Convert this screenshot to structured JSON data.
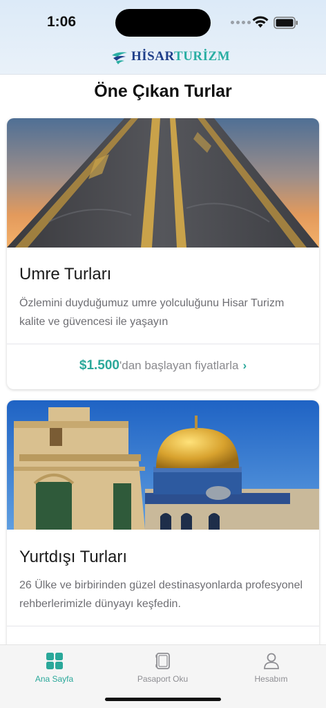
{
  "status_bar": {
    "time": "1:06"
  },
  "header": {
    "logo_part1": "HİSAR",
    "logo_part2": "TURİZM"
  },
  "page": {
    "title": "Öne Çıkan Turlar"
  },
  "cards": [
    {
      "title": "Umre Turları",
      "description": "Özlemini duyduğumuz umre yolculuğunu Hisar Turizm kalite ve güvencesi ile yaşayın",
      "price_amount": "$1.500",
      "price_suffix": "'dan başlayan fiyatlarla",
      "image": "kaaba-kiswah-photo"
    },
    {
      "title": "Yurtdışı Turları",
      "description": "26 Ülke ve birbirinden güzel destinasyonlarda profesyonel rehberlerimizle dünyayı keşfedin.",
      "image": "dome-of-the-rock-photo"
    }
  ],
  "tabbar": {
    "items": [
      {
        "label": "Ana Sayfa",
        "icon": "grid-icon",
        "active": true
      },
      {
        "label": "Pasaport Oku",
        "icon": "passport-icon",
        "active": false
      },
      {
        "label": "Hesabım",
        "icon": "user-icon",
        "active": false
      }
    ]
  },
  "colors": {
    "accent": "#2aa89a",
    "brand_blue": "#1f3f8a",
    "inactive": "#8e8e93"
  }
}
